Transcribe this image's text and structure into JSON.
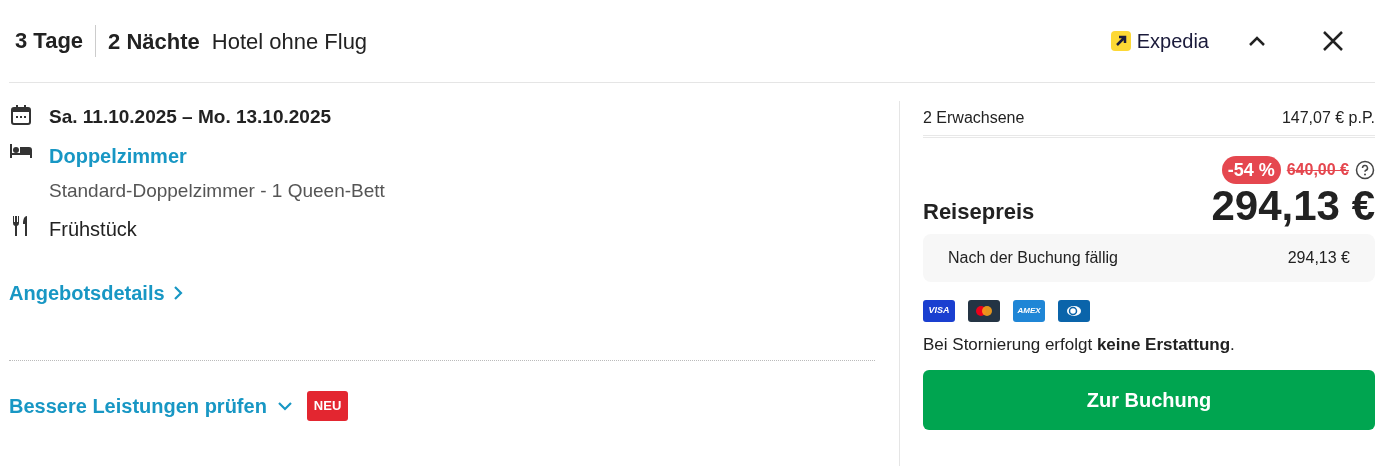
{
  "header": {
    "days": "3 Tage",
    "nights": "2 Nächte",
    "type": "Hotel ohne Flug",
    "provider": "Expedia",
    "expanded": true
  },
  "details": [
    {
      "kind": "date",
      "text": "Sa. 11.10.2025 – Mo. 13.10.2025"
    },
    {
      "kind": "room",
      "text": "Doppelzimmer",
      "subtext": "Standard-Doppelzimmer - 1 Queen-Bett"
    },
    {
      "kind": "meal",
      "text": "Frühstück"
    }
  ],
  "offer_link": "Angebotsdetails",
  "upgrade": {
    "label": "Bessere Leistungen prüfen",
    "badge": "NEU"
  },
  "price": {
    "travellers": "2 Erwachsene",
    "per_person": "147,07 € p.P.",
    "discount": "-54 %",
    "old_price": "640,00 €",
    "label": "Reisepreis",
    "total": "294,13 €",
    "due_label": "Nach der Buchung fällig",
    "due_amount": "294,13 €"
  },
  "cards": [
    {
      "kind": "visa",
      "label": "VISA"
    },
    {
      "kind": "mastercard"
    },
    {
      "kind": "amex",
      "label": "AMEX"
    },
    {
      "kind": "diners"
    }
  ],
  "cancellation": "Bei Stornierung erfolgt **keine Erstattung**.",
  "book_button": "Zur Buchung"
}
